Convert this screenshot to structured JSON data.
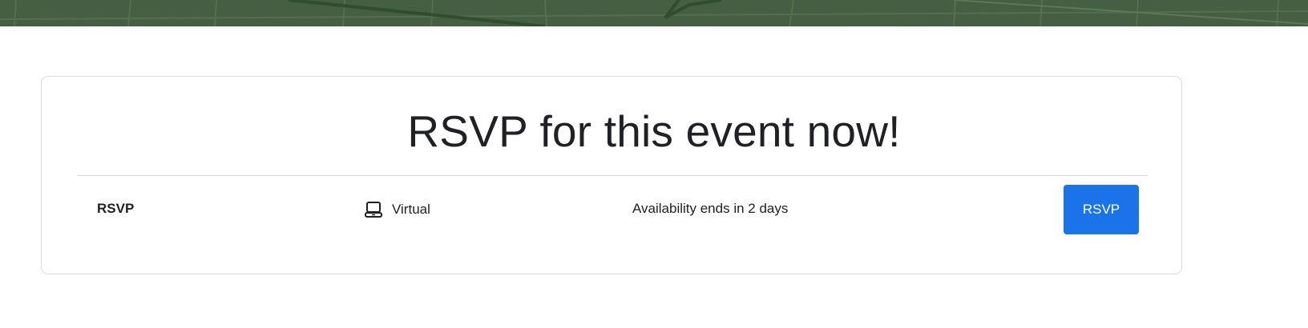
{
  "hero": {
    "color": "#445f43"
  },
  "card": {
    "heading": "RSVP for this event now!",
    "ticket_type": "RSVP",
    "location_icon": "laptop-icon",
    "location_label": "Virtual",
    "availability": "Availability ends in 2 days",
    "button_label": "RSVP",
    "accent_color": "#1a73e8"
  }
}
